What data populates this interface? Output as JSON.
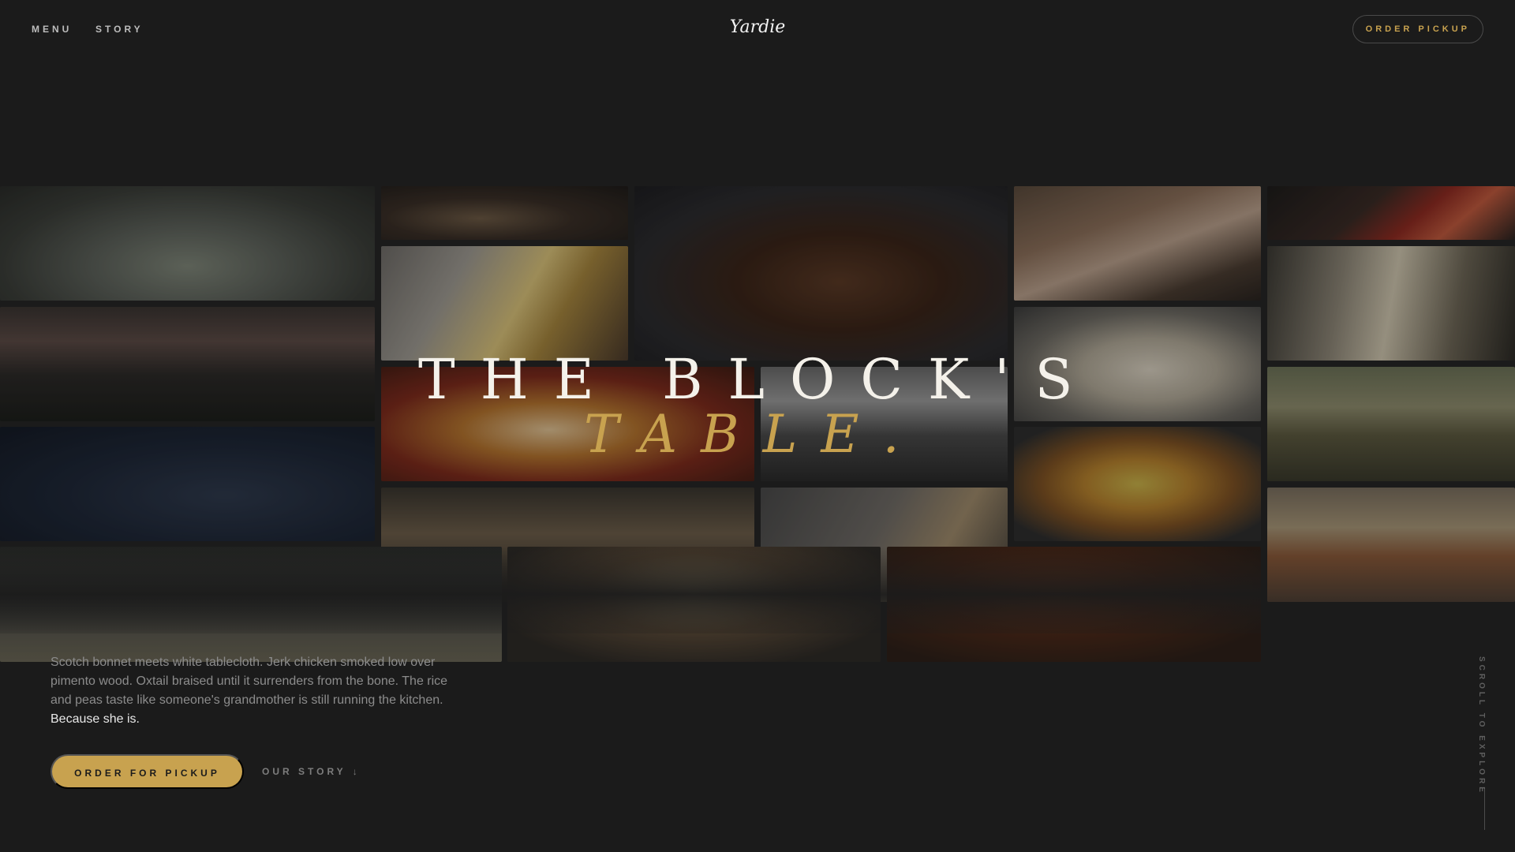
{
  "nav": {
    "menu_label": "MENU",
    "story_label": "STORY",
    "brand": "Yardie",
    "order_pickup_label": "ORDER PICKUP"
  },
  "mosaic": {
    "tiles": [
      "plated-dish",
      "grilled-dish",
      "braised-oxtail-bowl",
      "smiling-guest",
      "sausages-plate",
      "foil-pasta",
      "dining-room",
      "champagne-glasses",
      "rice-and-peas-plate",
      "chilies-on-board",
      "pizza-closeup",
      "office-gathering",
      "patties-and-rice",
      "garden-party",
      "dumplings",
      "takeout-bag",
      "buffet-spread",
      "street-night",
      "stew-plate",
      "oxtail-stew"
    ]
  },
  "hero": {
    "line1": "THE BLOCK'S",
    "line2": "TABLE."
  },
  "copy": {
    "text": "Scotch bonnet meets white tablecloth. Jerk chicken smoked low over pimento wood. Oxtail braised until it surrenders from the bone. The rice and peas taste like someone's grandmother is still running the kitchen.",
    "emphasis": "Because she is."
  },
  "cta": {
    "primary_label": "ORDER FOR PICKUP",
    "secondary_label": "OUR STORY",
    "secondary_icon": "arrow-down-icon"
  },
  "scroll": {
    "label": "SCROLL TO EXPLORE"
  },
  "colors": {
    "background": "#1b1b1b",
    "accent": "#c8a24f",
    "text_primary": "#f4f1ea",
    "text_muted": "#8c8c8c"
  }
}
